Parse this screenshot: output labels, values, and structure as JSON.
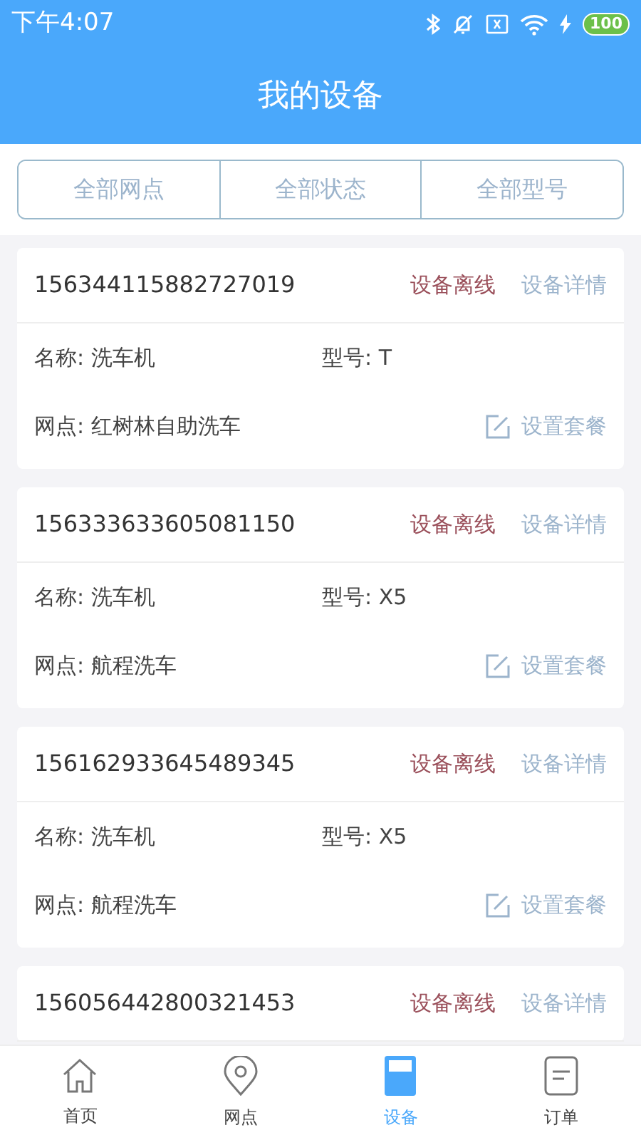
{
  "status_bar": {
    "time": "下午4:07",
    "battery": "100"
  },
  "header": {
    "title": "我的设备"
  },
  "filters": [
    {
      "label": "全部网点"
    },
    {
      "label": "全部状态"
    },
    {
      "label": "全部型号"
    }
  ],
  "devices": [
    {
      "id": "156344115882727019",
      "status": "设备离线",
      "detail": "设备详情",
      "name": "名称: 洗车机",
      "model": "型号: T",
      "site": "网点: 红树林自助洗车",
      "action": "设置套餐"
    },
    {
      "id": "156333633605081150",
      "status": "设备离线",
      "detail": "设备详情",
      "name": "名称: 洗车机",
      "model": "型号: X5",
      "site": "网点: 航程洗车",
      "action": "设置套餐"
    },
    {
      "id": "156162933645489345",
      "status": "设备离线",
      "detail": "设备详情",
      "name": "名称: 洗车机",
      "model": "型号: X5",
      "site": "网点: 航程洗车",
      "action": "设置套餐"
    },
    {
      "id": "156056442800321453",
      "status": "设备离线",
      "detail": "设备详情"
    }
  ],
  "nav": [
    {
      "kind": "home",
      "label": "首页",
      "selected": false
    },
    {
      "kind": "pin",
      "label": "网点",
      "selected": false
    },
    {
      "kind": "device",
      "label": "设备",
      "selected": true
    },
    {
      "kind": "order",
      "label": "订单",
      "selected": false
    }
  ]
}
